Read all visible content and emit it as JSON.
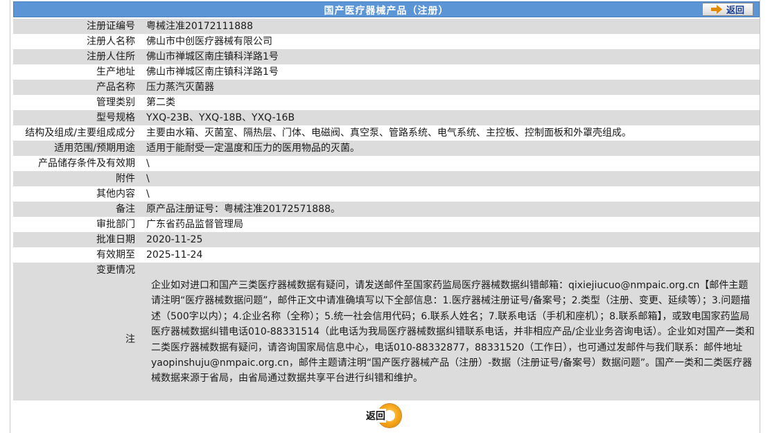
{
  "header": {
    "title": "国产医疗器械产品（注册）",
    "back_label": "返回"
  },
  "rows": [
    {
      "label": "注册证编号",
      "value": "粤械注准20172111888"
    },
    {
      "label": "注册人名称",
      "value": "佛山市中创医疗器械有限公司"
    },
    {
      "label": "注册人住所",
      "value": "佛山市禅城区南庄镇科洋路1号"
    },
    {
      "label": "生产地址",
      "value": "佛山市禅城区南庄镇科洋路1号"
    },
    {
      "label": "产品名称",
      "value": "压力蒸汽灭菌器"
    },
    {
      "label": "管理类别",
      "value": "第二类"
    },
    {
      "label": "型号规格",
      "value": "YXQ-23B、YXQ-18B、YXQ-16B"
    },
    {
      "label": "结构及组成/主要组成成分",
      "value": "主要由水箱、灭菌室、隔热层、门体、电磁阀、真空泵、管路系统、电气系统、主控板、控制面板和外罩壳组成。"
    },
    {
      "label": "适用范围/预期用途",
      "value": "适用于能耐受一定温度和压力的医用物品的灭菌。"
    },
    {
      "label": "产品储存条件及有效期",
      "value": "\\"
    },
    {
      "label": "附件",
      "value": "\\"
    },
    {
      "label": "其他内容",
      "value": "\\"
    },
    {
      "label": "备注",
      "value": "原产品注册证号：粤械注准20172571888。"
    },
    {
      "label": "审批部门",
      "value": "广东省药品监督管理局"
    },
    {
      "label": "批准日期",
      "value": "2020-11-25"
    },
    {
      "label": "有效期至",
      "value": "2025-11-24"
    }
  ],
  "changes_label": "变更情况",
  "note": {
    "label": "注",
    "text": "企业如对进口和国产三类医疗器械数据有疑问，请发送邮件至国家药监局医疗器械数据纠错邮箱：qixiejiucuo@nmpaic.org.cn【邮件主题请注明“医疗器械数据问题”，邮件正文中请准确填写以下全部信息：1.医疗器械注册证号/备案号；2.类型（注册、变更、延续等）；3.问题描述（500字以内）；4.企业名称（全称）；5.统一社会信用代码；6.联系人姓名；7.联系电话（手机和座机）；8.联系邮箱】，或致电国家药监局医疗器械数据纠错电话010-88331514（此电话为我局医疗器械数据纠错联系电话，并非相应产品/企业业务咨询电话）。企业如对国产一类和二类医疗器械数据有疑问，请咨询国家局信息中心，电话010-88332877，88331520（工作日），也可通过发邮件与我们联系：邮件地址yaopinshuju@nmpaic.org.cn，邮件主题请注明“国产医疗器械产品（注册）-数据（注册证号/备案号）数据问题”。国产一类和二类医疗器械数据来源于省局，由省局通过数据共享平台进行纠错和维护。"
  },
  "footer": {
    "back_label": "返回"
  },
  "colors": {
    "title_bar": "#5b95d6",
    "row_shade": "#dcdcdc",
    "back_icon": "#f5a315",
    "back_text": "#1a3f8f"
  }
}
